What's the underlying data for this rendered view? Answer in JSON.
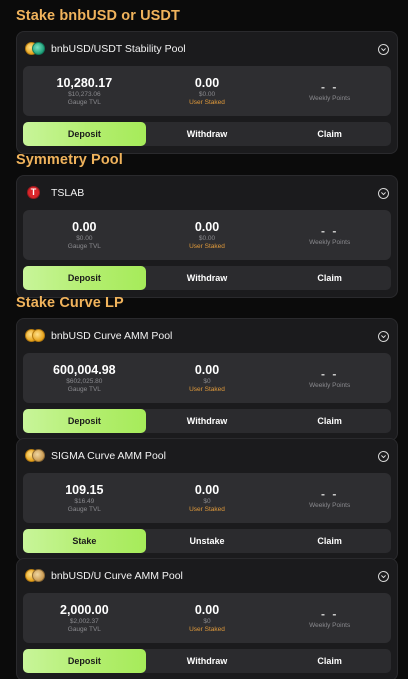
{
  "sections": [
    {
      "title": "Stake bnbUSD or USDT"
    },
    {
      "title": "Symmetry Pool"
    },
    {
      "title": "Stake Curve LP"
    }
  ],
  "pools": [
    {
      "name": "bnbUSD/USDT Stability Pool",
      "icon": "bnbusd-usdt-coins-icon",
      "tvl_value": "10,280.17",
      "tvl_sub": "$10,273.06",
      "tvl_label": "Gauge TVL",
      "staked_value": "0.00",
      "staked_sub": "$0.00",
      "staked_label": "User Staked",
      "points_value": "- -",
      "points_label": "Weekly Points",
      "actions": [
        "Deposit",
        "Withdraw",
        "Claim"
      ]
    },
    {
      "name": "TSLAB",
      "icon": "tesla-icon",
      "tvl_value": "0.00",
      "tvl_sub": "$0.00",
      "tvl_label": "Gauge TVL",
      "staked_value": "0.00",
      "staked_sub": "$0.00",
      "staked_label": "User Staked",
      "points_value": "- -",
      "points_label": "Weekly Points",
      "actions": [
        "Deposit",
        "Withdraw",
        "Claim"
      ]
    },
    {
      "name": "bnbUSD Curve AMM Pool",
      "icon": "bnbusd-curve-coins-icon",
      "tvl_value": "600,004.98",
      "tvl_sub": "$602,025.80",
      "tvl_label": "Gauge TVL",
      "staked_value": "0.00",
      "staked_sub": "$0",
      "staked_label": "User Staked",
      "points_value": "- -",
      "points_label": "Weekly Points",
      "actions": [
        "Deposit",
        "Withdraw",
        "Claim"
      ]
    },
    {
      "name": "SIGMA Curve AMM Pool",
      "icon": "sigma-curve-coins-icon",
      "tvl_value": "109.15",
      "tvl_sub": "$16.49",
      "tvl_label": "Gauge TVL",
      "staked_value": "0.00",
      "staked_sub": "$0",
      "staked_label": "User Staked",
      "points_value": "- -",
      "points_label": "Weekly Points",
      "actions": [
        "Stake",
        "Unstake",
        "Claim"
      ]
    },
    {
      "name": "bnbUSD/U Curve AMM Pool",
      "icon": "bnbusd-u-curve-coins-icon",
      "tvl_value": "2,000.00",
      "tvl_sub": "$2,002.37",
      "tvl_label": "Gauge TVL",
      "staked_value": "0.00",
      "staked_sub": "$0",
      "staked_label": "User Staked",
      "points_value": "- -",
      "points_label": "Weekly Points",
      "actions": [
        "Deposit",
        "Withdraw",
        "Claim"
      ]
    }
  ],
  "colors": {
    "section_title": "#f0b35c",
    "primary_button": "#b3ee6f",
    "user_staked_label": "#e09a3b",
    "card_bg": "#1b1b1d",
    "page_bg": "#0b0b0b"
  }
}
